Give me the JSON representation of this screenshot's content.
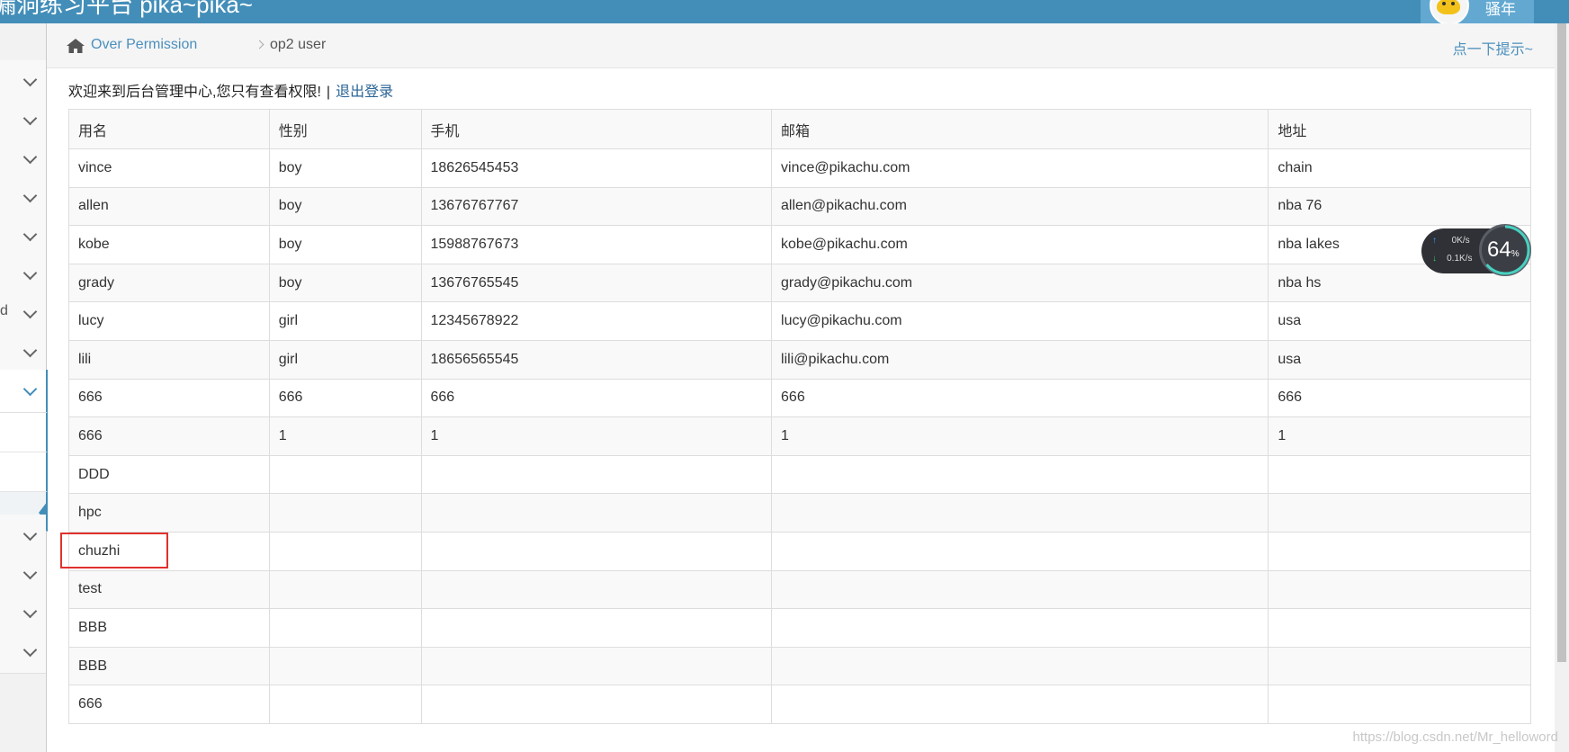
{
  "header": {
    "brand": "漏洞练习平台 pika~pika~",
    "user_name": "骚年"
  },
  "breadcrumb": {
    "parent": "Over Permission",
    "current": "op2 user",
    "hint": "点一下提示~"
  },
  "welcome": {
    "message": "欢迎来到后台管理中心,您只有查看权限!",
    "separator": "|",
    "logout": "退出登录"
  },
  "sidebar": {
    "partial_label": "d"
  },
  "table": {
    "headers": [
      "用名",
      "性别",
      "手机",
      "邮箱",
      "地址"
    ],
    "rows": [
      [
        "vince",
        "boy",
        "18626545453",
        "vince@pikachu.com",
        "chain"
      ],
      [
        "allen",
        "boy",
        "13676767767",
        "allen@pikachu.com",
        "nba 76"
      ],
      [
        "kobe",
        "boy",
        "15988767673",
        "kobe@pikachu.com",
        "nba lakes"
      ],
      [
        "grady",
        "boy",
        "13676765545",
        "grady@pikachu.com",
        "nba hs"
      ],
      [
        "lucy",
        "girl",
        "12345678922",
        "lucy@pikachu.com",
        "usa"
      ],
      [
        "lili",
        "girl",
        "18656565545",
        "lili@pikachu.com",
        "usa"
      ],
      [
        "666",
        "666",
        "666",
        "666",
        "666"
      ],
      [
        "666",
        "1",
        "1",
        "1",
        "1"
      ],
      [
        "DDD",
        "",
        "",
        "",
        ""
      ],
      [
        "hpc",
        "",
        "",
        "",
        ""
      ],
      [
        "chuzhi",
        "",
        "",
        "",
        ""
      ],
      [
        "test",
        "",
        "",
        "",
        ""
      ],
      [
        "BBB",
        "",
        "",
        "",
        ""
      ],
      [
        "BBB",
        "",
        "",
        "",
        ""
      ],
      [
        "666",
        "",
        "",
        "",
        ""
      ]
    ]
  },
  "net_widget": {
    "upload": "0",
    "download": "0.1",
    "unit": "K/s",
    "percent": "64",
    "percent_unit": "%"
  },
  "watermark": "https://blog.csdn.net/Mr_helloword",
  "colors": {
    "header": "#438eb9",
    "link": "#4c8fbd",
    "highlight": "#e0312d"
  }
}
